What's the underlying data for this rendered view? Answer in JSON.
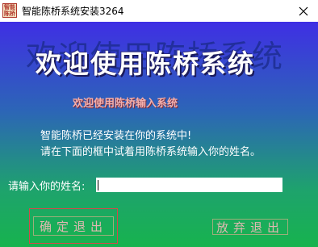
{
  "window": {
    "title": "智能陈桥系统安装3264",
    "icon_text": "智能陈桥",
    "close_glyph": "✕"
  },
  "banner": {
    "shadow_title": "欢迎使用陈桥系统",
    "title": "欢迎使用陈桥系统",
    "subtitle": "欢迎使用陈桥输入系统"
  },
  "message": {
    "line1": "智能陈桥已经安装在你的系统中!",
    "line2": "请在下面的框中试着用陈桥系统输入你的姓名。"
  },
  "name_field": {
    "label": "请输入你的姓名:",
    "value": ""
  },
  "buttons": {
    "confirm_label": "确定退出",
    "cancel_label": "放弃退出"
  },
  "colors": {
    "gradient_top": "#3f2fe4",
    "gradient_bottom": "#17b34e",
    "focus_border": "#d14a4a",
    "button_text": "#e2b9b2"
  }
}
